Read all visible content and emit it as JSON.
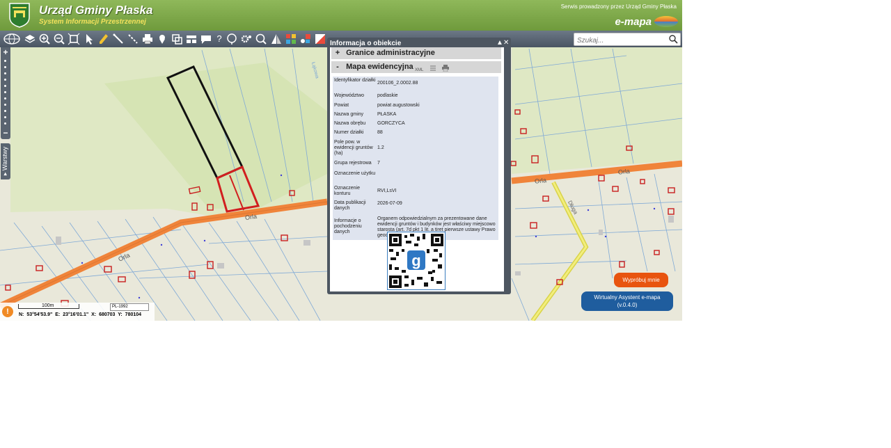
{
  "header": {
    "title": "Urząd Gminy Płaska",
    "subtitle": "System Informacji Przestrzennej",
    "provider": "Serwis prowadzony przez Urząd Gminy Płaska",
    "brand": "e-mapa"
  },
  "toolbar": {
    "search_placeholder": "Szukaj...",
    "icons": [
      "globe-icon",
      "layers-icon",
      "zoom-in-icon",
      "zoom-out-icon",
      "zoom-extent-icon",
      "pointer-icon",
      "pencil-icon",
      "measure-line-icon",
      "measure-area-icon",
      "print-icon",
      "pin-icon",
      "copy-icon",
      "table-icon",
      "comment-icon",
      "help-icon",
      "route-icon",
      "settings-icon",
      "search-map-icon",
      "perspective-icon",
      "apps-icon",
      "share-icon",
      "eraser-icon"
    ]
  },
  "left_panel": {
    "zoom_in": "+",
    "zoom_out": "−",
    "layers_tab": "▸ Warstwy"
  },
  "map": {
    "road_labels": [
      "Orla",
      "Orla",
      "Orla",
      "Orla",
      "Orla"
    ],
    "street_labels": [
      "Długa",
      "Łąkowa"
    ]
  },
  "dialog": {
    "title": "Informacja o obiekcie",
    "min": "▲",
    "close": "✕",
    "sections": [
      {
        "sign": "+",
        "label": "Granice administracyjne"
      },
      {
        "sign": "-",
        "label": "Mapa ewidencyjna",
        "xml": "XML"
      }
    ],
    "rows": [
      {
        "key": "Identyfikator działki",
        "value": "200106_2.0002.88"
      },
      {
        "key": "Województwo",
        "value": "podlaskie"
      },
      {
        "key": "Powiat",
        "value": "powiat augustowski"
      },
      {
        "key": "Nazwa gminy",
        "value": "PŁASKA"
      },
      {
        "key": "Nazwa obrębu",
        "value": "GORCZYCA"
      },
      {
        "key": "Numer działki",
        "value": "88"
      },
      {
        "key": "Pole pow. w ewidencji gruntów (ha)",
        "value": "1.2"
      },
      {
        "key": "Grupa rejestrowa",
        "value": "7"
      },
      {
        "key": "Oznaczenie użytku",
        "value": ""
      },
      {
        "key": "Oznaczenie konturu",
        "value": "RVI,LsVI"
      },
      {
        "key": "Data publikacji danych",
        "value": "2026-07-09"
      },
      {
        "key": "Informacje o pochodzeniu danych",
        "value": "Organem odpowiedzialnym za prezentowane dane ewidencji gruntów i budynków jest właściwy miejscowo starosta (art. 7d pkt 1 lit. a tiret pierwsze ustawy Prawo geodezyjne i kartograficzne)."
      }
    ]
  },
  "status": {
    "scale": "100m",
    "crs": "PL-1992",
    "coords": "N: 53°54'53.9\"  E: 23°16'01.1\"   X: 680703     Y: 780104"
  },
  "assistant": {
    "try": "Wypróbuj mnie",
    "title": "Wirtualny Asystent e-mapa",
    "version": "(v.0.4.0)"
  },
  "colors": {
    "header": "#7ea64a",
    "toolbar": "#5a6470",
    "road": "#f0843a",
    "parcel": "#d11f1f",
    "assist": "#1f5d9e",
    "try": "#e8540f"
  }
}
